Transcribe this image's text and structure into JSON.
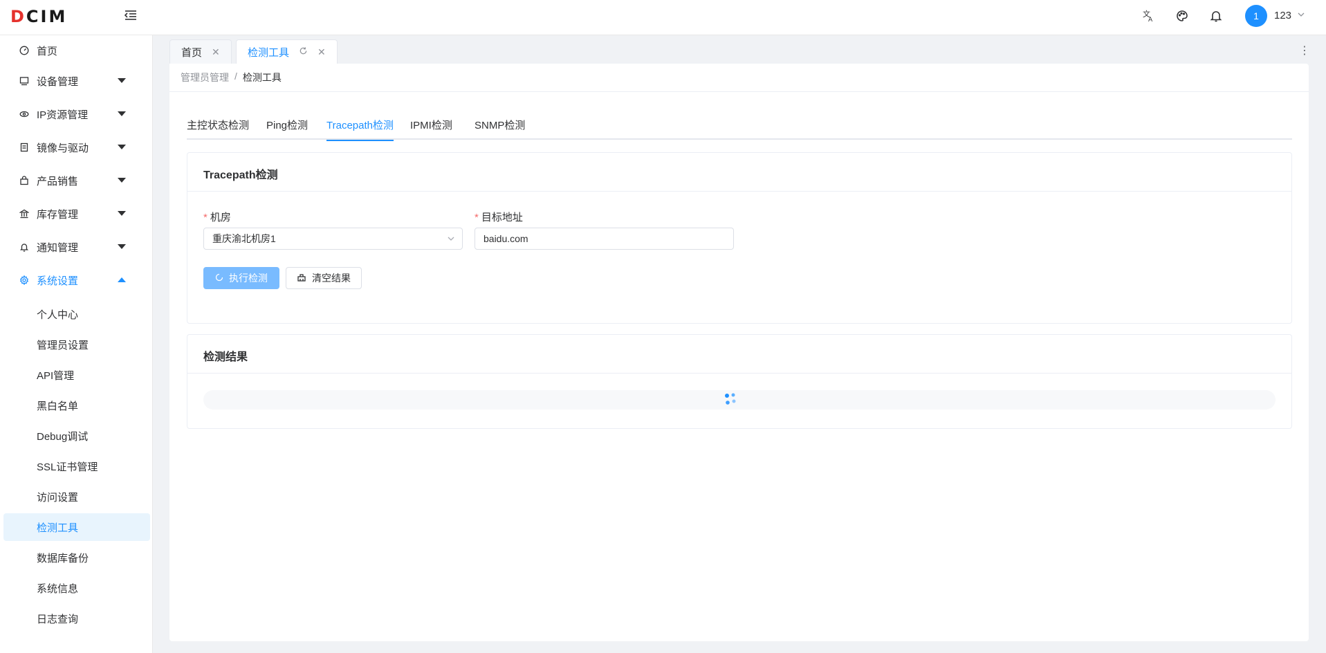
{
  "header": {
    "logo_text_accent": "D",
    "logo_text_rest": "CIM",
    "avatar_text": "1",
    "username": "123",
    "icons": [
      "menu-collapse-icon",
      "translate-icon",
      "palette-icon",
      "bell-icon",
      "chevron-down-icon"
    ]
  },
  "sidebar": {
    "items": [
      {
        "label": "首页",
        "icon": "dashboard-icon"
      },
      {
        "label": "设备管理",
        "icon": "monitor-icon"
      },
      {
        "label": "IP资源管理",
        "icon": "network-icon"
      },
      {
        "label": "镜像与驱动",
        "icon": "document-icon"
      },
      {
        "label": "产品销售",
        "icon": "bag-icon"
      },
      {
        "label": "库存管理",
        "icon": "bank-icon"
      },
      {
        "label": "通知管理",
        "icon": "bell-icon"
      },
      {
        "label": "系统设置",
        "icon": "gear-icon"
      }
    ],
    "sub_items": [
      "个人中心",
      "管理员设置",
      "API管理",
      "黑白名单",
      "Debug调试",
      "SSL证书管理",
      "访问设置",
      "检测工具",
      "数据库备份",
      "系统信息",
      "日志查询"
    ],
    "active_sub": "检测工具"
  },
  "tabs": [
    {
      "label": "首页"
    },
    {
      "label": "检测工具"
    }
  ],
  "breadcrumb": {
    "parent": "管理员管理",
    "separator": "/",
    "current": "检测工具"
  },
  "subtabs": [
    "主控状态检测",
    "Ping检测",
    "Tracepath检测",
    "IPMI检测",
    "SNMP检测"
  ],
  "active_subtab": "Tracepath检测",
  "form_panel": {
    "title": "Tracepath检测",
    "room_label": "机房",
    "room_value": "重庆渝北机房1",
    "target_label": "目标地址",
    "target_value": "baidu.com",
    "required_mark": "*",
    "run_button": "执行检测",
    "clear_button": "清空结果"
  },
  "result_panel": {
    "title": "检测结果"
  },
  "colors": {
    "primary": "#1e90ff",
    "primary_light": "#79bbff",
    "danger": "#f56c6c",
    "active_bg": "#e8f4fd"
  }
}
